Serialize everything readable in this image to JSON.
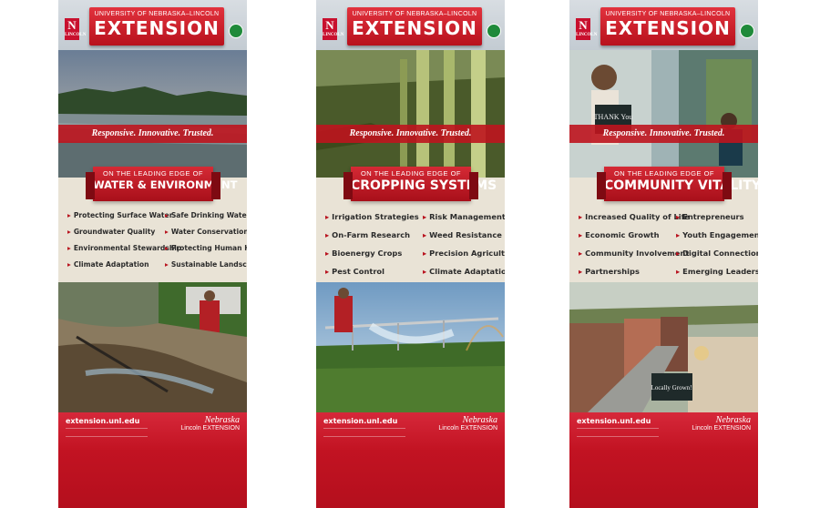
{
  "header": {
    "university": "UNIVERSITY OF NEBRASKA–LINCOLN",
    "title": "EXTENSION",
    "n_logo": "N",
    "n_logo_sub": "LINCOLN"
  },
  "tagline": "Responsive. Innovative. Trusted.",
  "lead": "ON THE LEADING EDGE OF",
  "footer": {
    "url": "extension.unl.edu",
    "wordmark": "Nebraska",
    "wordmark_sub": "Lincoln",
    "wordmark_ext": "EXTENSION"
  },
  "banners": [
    {
      "topic": "WATER & ENVIRONMENT",
      "items": [
        "Protecting Surface Water",
        "Safe Drinking Water",
        "Groundwater Quality",
        "Water Conservation",
        "Environmental Stewardship",
        "Protecting Human Health",
        "Climate Adaptation",
        "Sustainable Landscapes"
      ]
    },
    {
      "topic": "CROPPING SYSTEMS",
      "items": [
        "Irrigation Strategies",
        "Risk Management",
        "On-Farm Research",
        "Weed Resistance",
        "Bioenergy Crops",
        "Precision Agriculture",
        "Pest Control",
        "Climate Adaptation"
      ]
    },
    {
      "topic": "COMMUNITY VITALITY",
      "items": [
        "Increased Quality of Life",
        "Entrepreneurs",
        "Economic Growth",
        "Youth Engagement",
        "Community Involvement",
        "Digital Connections",
        "Partnerships",
        "Emerging Leaders"
      ],
      "signs": [
        "THANK You",
        "Locally Grown!"
      ]
    }
  ],
  "colors": {
    "brand_red": "#c8102e",
    "cream": "#e9e3d6"
  }
}
